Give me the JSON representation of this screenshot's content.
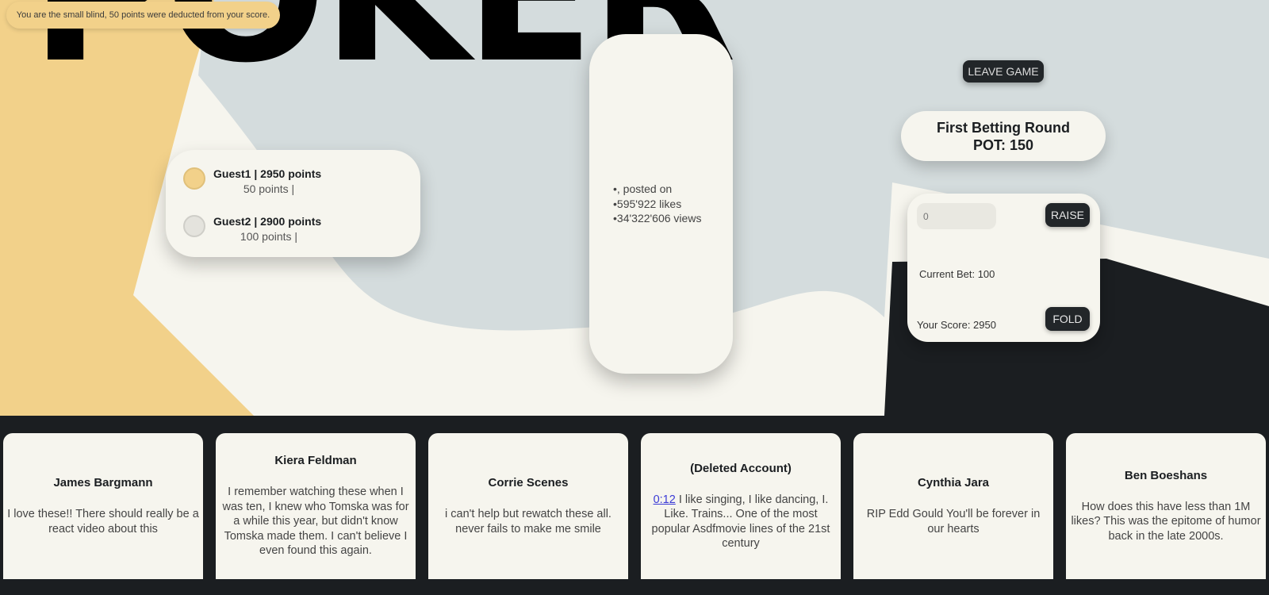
{
  "title": "POKER",
  "notification": "You are the small blind, 50 points were deducted from your score.",
  "players": [
    {
      "name_line": "Guest1 | 2950 points",
      "bet_line": "50 points |",
      "chip_color": "#f2d18a"
    },
    {
      "name_line": "Guest2 | 2900 points",
      "bet_line": "100 points |",
      "chip_color": "#e4e3dd"
    }
  ],
  "video": {
    "items": [
      ", posted on",
      "595'922 likes",
      "34'322'606 views"
    ]
  },
  "leave_button": "LEAVE GAME",
  "round": {
    "name": "First Betting Round",
    "pot": "POT: 150"
  },
  "controls": {
    "input_placeholder": "0",
    "raise_label": "RAISE",
    "current_bet": "Current Bet: 100",
    "your_score": "Your Score: 2950",
    "fold_label": "FOLD"
  },
  "comments": [
    {
      "author": "James Bargmann",
      "timestamp": "",
      "text": "I love these!! There should really be a react video about this"
    },
    {
      "author": "Kiera Feldman",
      "timestamp": "",
      "text": "I remember watching these when I was ten, I knew who Tomska was for a while this year, but didn't know Tomska made them. I can't believe I even found this again."
    },
    {
      "author": "Corrie Scenes",
      "timestamp": "",
      "text": "i can't help but rewatch these all. never fails to make me smile"
    },
    {
      "author": "(Deleted Account)",
      "timestamp": "0:12",
      "text": " I like singing, I like dancing, I. Like. Trains... One of the most popular Asdfmovie lines of the 21st century"
    },
    {
      "author": "Cynthia Jara",
      "timestamp": "",
      "text": "RIP Edd Gould You'll be forever in our hearts"
    },
    {
      "author": "Ben Boeshans",
      "timestamp": "",
      "text": "How does this have less than 1M likes? This was the epitome of humor back in the late 2000s."
    }
  ],
  "colors": {
    "yellow": "#f2d18a",
    "cream": "#f6f5ee",
    "gray": "#d4dcdd",
    "dark": "#1b1e21"
  }
}
